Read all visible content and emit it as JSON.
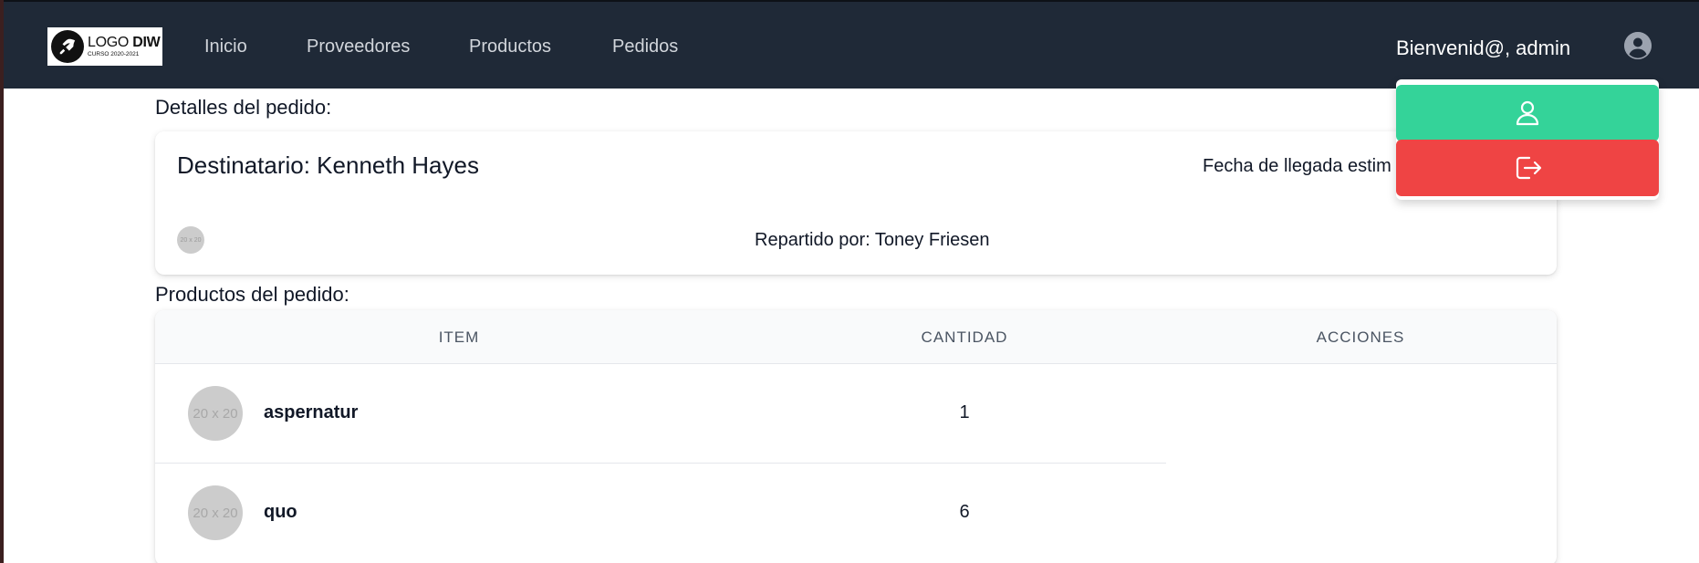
{
  "navbar": {
    "logo": {
      "title_light": "LOGO ",
      "title_bold": "DIW",
      "subtitle": "CURSO 2020-2021"
    },
    "links": [
      {
        "label": "Inicio"
      },
      {
        "label": "Proveedores"
      },
      {
        "label": "Productos"
      },
      {
        "label": "Pedidos"
      }
    ],
    "welcome": "Bienvenid@, admin",
    "user_icon": "user-circle-icon"
  },
  "dropdown": {
    "profile_icon": "user-icon",
    "logout_icon": "logout-icon",
    "profile_color": "#34d399",
    "logout_color": "#ef4444"
  },
  "details": {
    "section_title": "Detalles del pedido:",
    "recipient": "Destinatario: Kenneth Hayes",
    "arrival": "Fecha de llegada estim",
    "courier_avatar_text": "20 x 20",
    "courier": "Repartido por: Toney Friesen"
  },
  "products": {
    "section_title": "Productos del pedido:",
    "columns": [
      "ITEM",
      "CANTIDAD",
      "ACCIONES"
    ],
    "rows": [
      {
        "avatar_text": "20 x 20",
        "name": "aspernatur",
        "quantity": "1"
      },
      {
        "avatar_text": "20 x 20",
        "name": "quo",
        "quantity": "6"
      }
    ]
  },
  "colors": {
    "navbar_bg": "#1f2937",
    "nav_text": "#d1d5db"
  }
}
